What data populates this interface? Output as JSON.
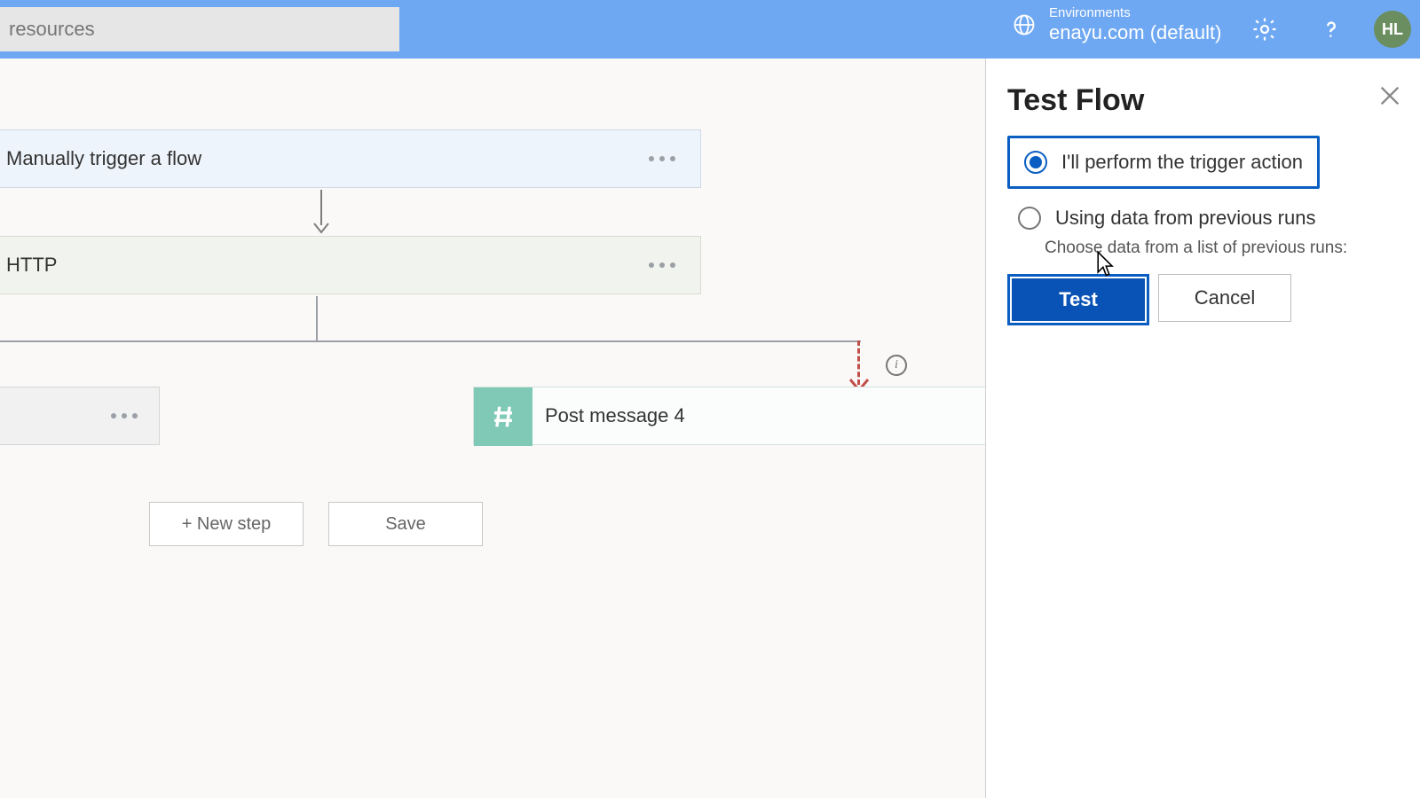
{
  "header": {
    "search_placeholder": "resources",
    "env_label": "Environments",
    "env_name": "enayu.com (default)",
    "avatar_initials": "HL"
  },
  "flow": {
    "trigger_label": "Manually trigger a flow",
    "http_label": "HTTP",
    "post_label": "Post message 4",
    "new_step_label": "+ New step",
    "save_label": "Save"
  },
  "panel": {
    "title": "Test Flow",
    "option1": "I'll perform the trigger action",
    "option2": "Using data from previous runs",
    "subnote": "Choose data from a list of previous runs:",
    "test_btn": "Test",
    "cancel_btn": "Cancel"
  }
}
